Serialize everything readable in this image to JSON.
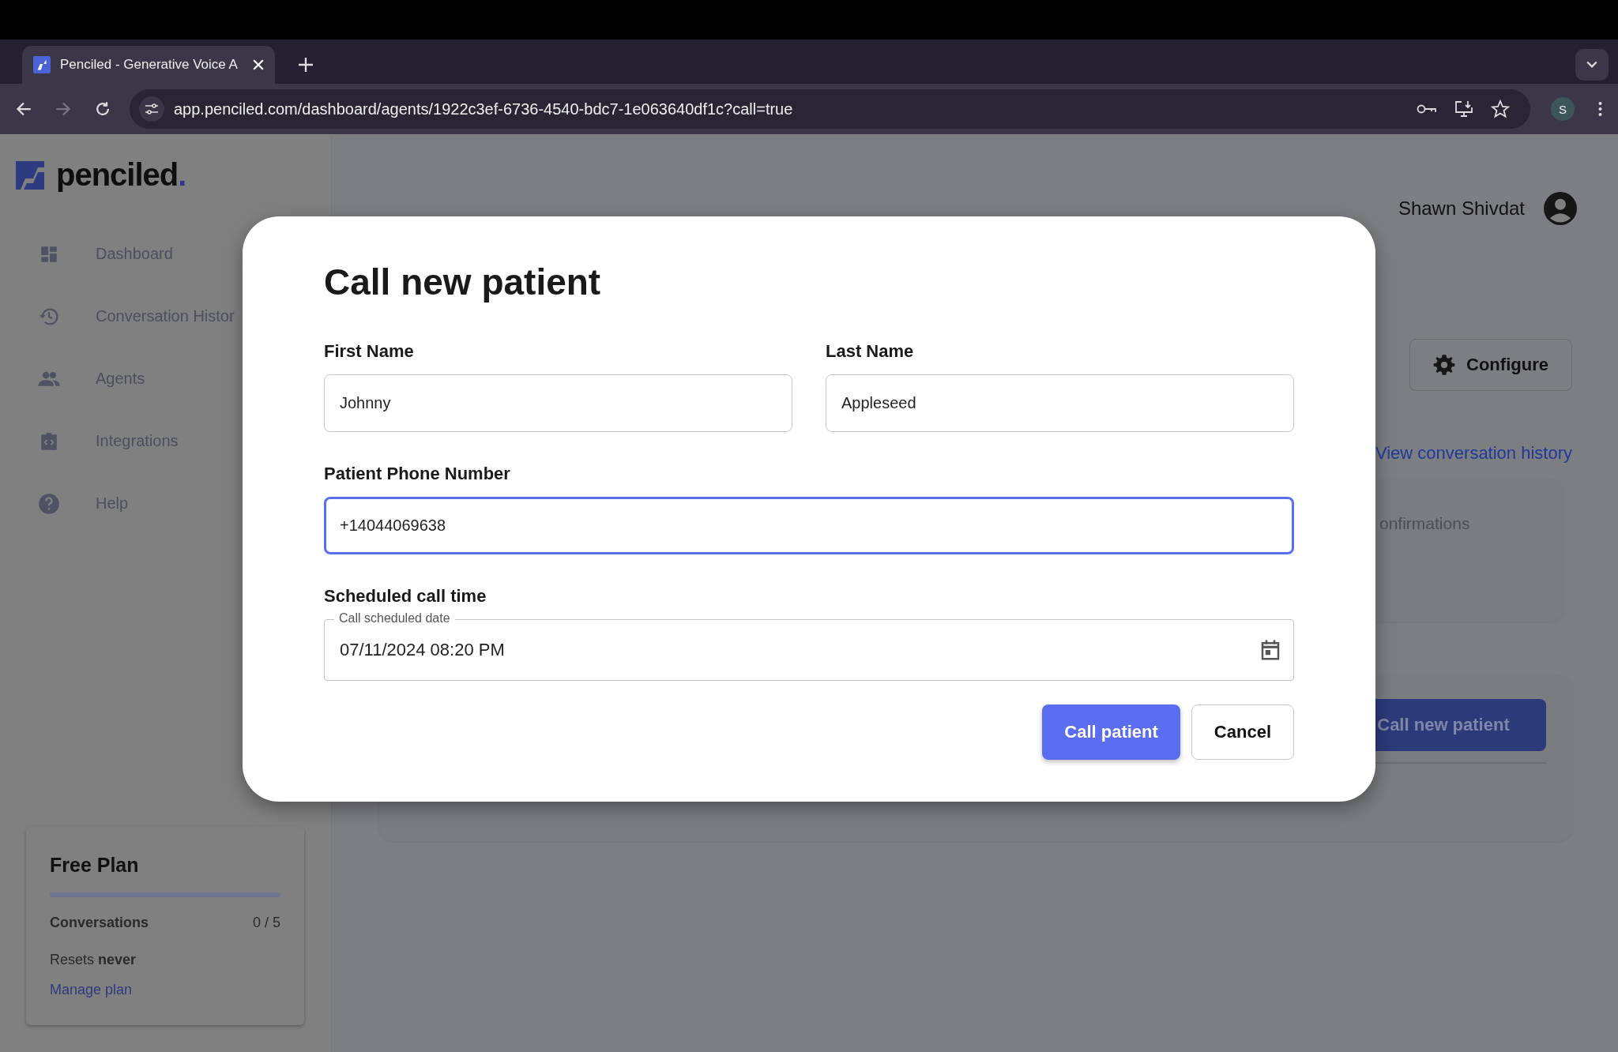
{
  "browser": {
    "tabs": [
      {
        "title": "Penciled - Generative Voice A",
        "selected": true
      }
    ],
    "url": "app.penciled.com/dashboard/agents/1922c3ef-6736-4540-bdc7-1e063640df1c?call=true",
    "profile_initial": "S",
    "forward_disabled": true
  },
  "sidebar": {
    "logo": {
      "text": "penciled",
      "mark": "."
    },
    "items": [
      {
        "label": "Dashboard"
      },
      {
        "label": "Conversation Histor"
      },
      {
        "label": "Agents"
      },
      {
        "label": "Integrations"
      },
      {
        "label": "Help"
      }
    ],
    "plan": {
      "title": "Free Plan",
      "level": 0,
      "usage_label": "Conversations",
      "usage": "0 / 5",
      "resets": "Resets **never**",
      "link": "Manage plan"
    }
  },
  "header": {
    "user": "Shawn Shivdat"
  },
  "agent": {
    "configure": "Configure",
    "history_link": "View conversation history",
    "stat_label": "onfirmations",
    "call_button": "Call new patient"
  },
  "modal": {
    "title": "Call new patient",
    "first_name": {
      "label": "First Name",
      "value": "Johnny",
      "focused": false
    },
    "last_name": {
      "label": "Last Name",
      "value": "Appleseed",
      "focused": false
    },
    "phone": {
      "label": "Patient Phone Number",
      "value": "+14044069638",
      "focused": true
    },
    "schedule": {
      "label": "Scheduled call time",
      "field_label": "Call scheduled date",
      "value": "07/11/2024 08:20 PM"
    },
    "buttons": [
      {
        "label": "Call patient",
        "kind": "primary"
      },
      {
        "label": "Cancel",
        "kind": "secondary"
      }
    ]
  }
}
